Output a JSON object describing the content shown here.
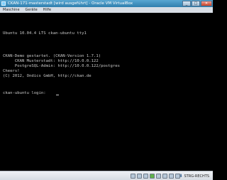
{
  "window": {
    "title": "CKAN-171-masterstadt [wird ausgeführt] - Oracle VM VirtualBox",
    "minimize": "_",
    "maximize": "□",
    "close": "✕"
  },
  "menu": {
    "items": [
      "Maschine",
      "Geräte",
      "Hilfe"
    ]
  },
  "console": {
    "lines": [
      "Ubuntu 10.04.4 LTS ckan-ubuntu tty1",
      "CKAN-Demo gestartet. (CKAN-Version 1.7.1)",
      "     CKAN Musterstadt: http://10.0.0.122",
      "     PostgreSQL-Admin: http://10.0.0.122/postgres",
      "Cheers!",
      "(C) 2012, Ondics GmbH, http://ckan.de",
      "ckan-ubuntu login: "
    ]
  },
  "statusbar": {
    "icons": [
      "hdd-icon",
      "cd-icon",
      "usb-icon",
      "network-icon",
      "shared-folder-icon",
      "display-icon",
      "capture-icon",
      "mouse-integration-icon"
    ],
    "host_key_arrow": "⬇",
    "host_key_label": "STRG-RECHTS"
  }
}
